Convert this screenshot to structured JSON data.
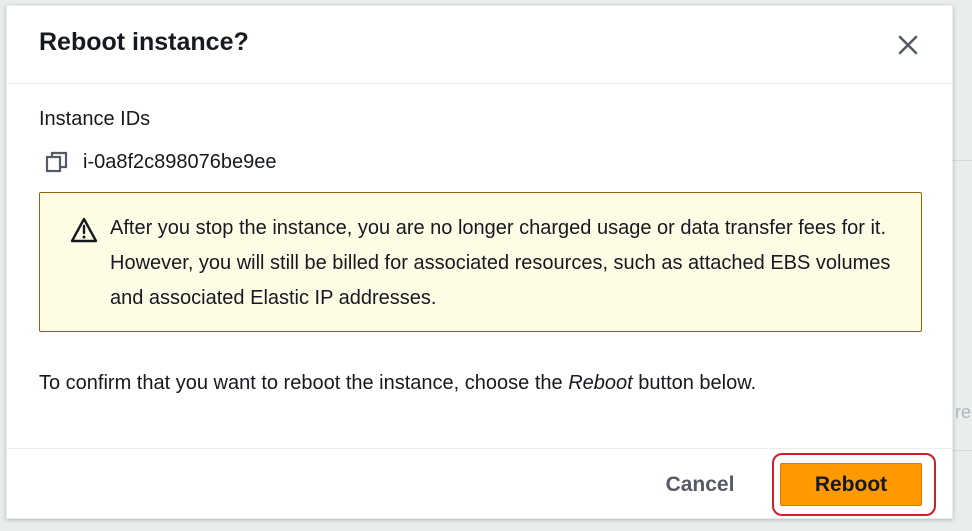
{
  "modal": {
    "title": "Reboot instance?",
    "close_icon": "close-icon"
  },
  "instance": {
    "label": "Instance IDs",
    "id": "i-0a8f2c898076be9ee",
    "copy_icon": "copy-icon"
  },
  "alert": {
    "icon": "warning-icon",
    "text": "After you stop the instance, you are no longer charged usage or data transfer fees for it. However, you will still be billed for associated resources, such as attached EBS volumes and associated Elastic IP addresses."
  },
  "confirm": {
    "prefix": "To confirm that you want to reboot the instance, choose the ",
    "emphasis": "Reboot",
    "suffix": " button below."
  },
  "footer": {
    "cancel_label": "Cancel",
    "reboot_label": "Reboot"
  },
  "background": {
    "ghost_text": "re"
  },
  "colors": {
    "primary_button": "#ff9900",
    "alert_background": "#fffce6",
    "alert_border": "#8d6605",
    "highlight_ring": "#d21d2a"
  }
}
